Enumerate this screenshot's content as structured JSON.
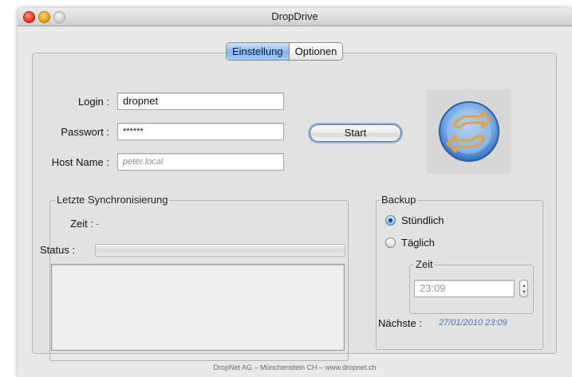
{
  "window": {
    "title": "DropDrive"
  },
  "tabs": [
    {
      "label": "Einstellung",
      "active": true
    },
    {
      "label": "Optionen",
      "active": false
    }
  ],
  "form": {
    "login_label": "Login :",
    "login_value": "dropnet",
    "password_label": "Passwort :",
    "password_value": "******",
    "host_label": "Host Name :",
    "host_placeholder": "peter.local",
    "start_label": "Start"
  },
  "sync": {
    "group_title": "Letzte Synchronisierung",
    "time_label": "Zeit :",
    "time_value": "-",
    "status_label": "Status :"
  },
  "backup": {
    "group_title": "Backup",
    "options": [
      {
        "label": "Stündlich",
        "selected": true
      },
      {
        "label": "Täglich",
        "selected": false
      }
    ],
    "time_group_title": "Zeit",
    "time_value": "23:09",
    "next_label": "Nächste :",
    "next_value": "27/01/2010 23:09"
  },
  "footer": {
    "text": "DropNet AG – Münchenstein CH – www.dropnet.ch"
  },
  "icons": {
    "logo": "sync-arrows-icon",
    "colors": {
      "accent": "#4a84d2",
      "arrow": "#e5a23a",
      "link": "#4b74ad"
    }
  }
}
